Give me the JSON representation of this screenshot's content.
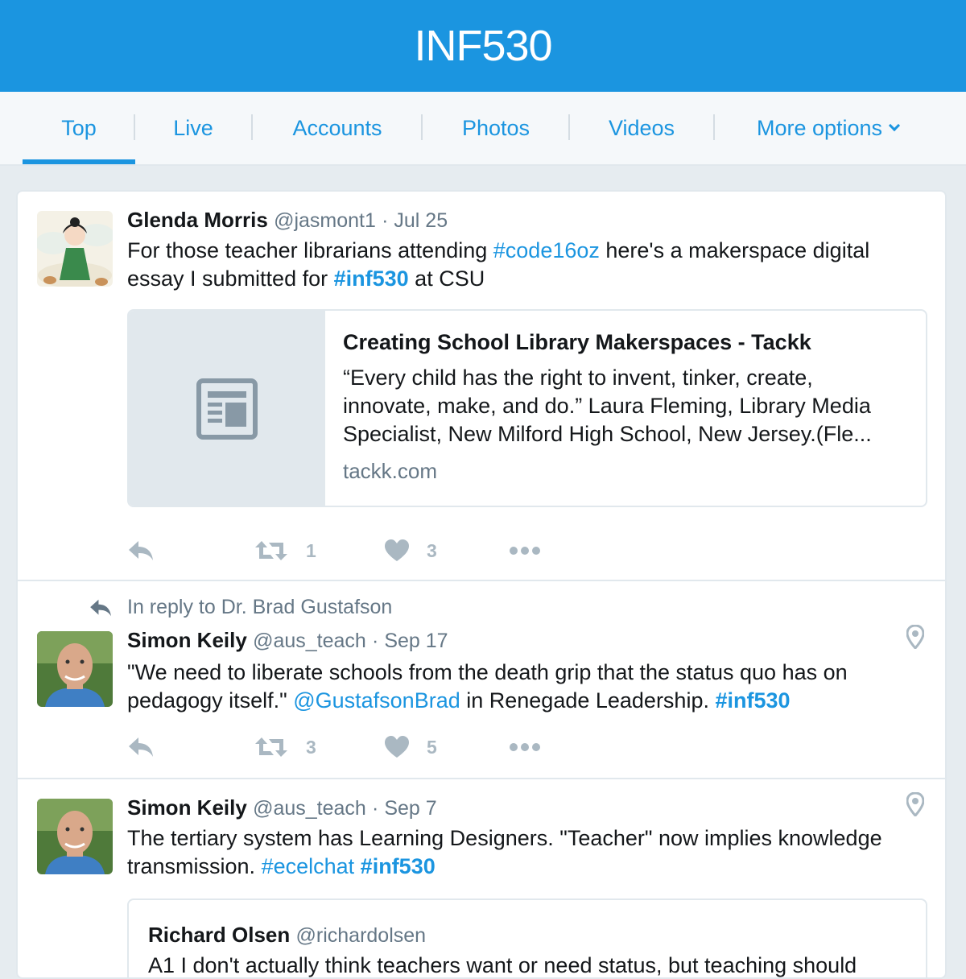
{
  "header": {
    "title": "INF530"
  },
  "tabs": [
    {
      "label": "Top",
      "active": true
    },
    {
      "label": "Live"
    },
    {
      "label": "Accounts"
    },
    {
      "label": "Photos"
    },
    {
      "label": "Videos"
    },
    {
      "label": "More options"
    }
  ],
  "tweets": [
    {
      "name": "Glenda Morris",
      "handle": "@jasmont1",
      "date": "· Jul 25",
      "text_parts": [
        "For those teacher librarians attending ",
        "#code16oz",
        " here's a makerspace digital essay I submitted for ",
        "#inf530",
        " at CSU"
      ],
      "card": {
        "title": "Creating School Library Makerspaces - Tackk",
        "description": "“Every child has the right to invent, tinker, create, innovate, make, and do.” Laura Fleming, Library Media Specialist, New Milford High School, New Jersey.(Fle...",
        "domain": "tackk.com"
      },
      "retweets": "1",
      "likes": "3"
    },
    {
      "reply_context": "In reply to Dr. Brad Gustafson",
      "name": "Simon Keily",
      "handle": "@aus_teach",
      "date": "· Sep 17",
      "text_parts": [
        "\"We need to liberate schools from the death grip that the status quo has on pedagogy itself.\" ",
        "@GustafsonBrad",
        " in Renegade Leadership. ",
        "#inf530"
      ],
      "retweets": "3",
      "likes": "5"
    },
    {
      "name": "Simon Keily",
      "handle": "@aus_teach",
      "date": "· Sep 7",
      "text_parts": [
        "The tertiary system has Learning Designers. \"Teacher\" now implies knowledge transmission. ",
        "#ecelchat",
        " ",
        "#inf530"
      ],
      "quote": {
        "name": "Richard Olsen",
        "handle": "@richardolsen",
        "text": "A1 I don't actually think teachers want or need status, but teaching should"
      }
    }
  ],
  "colors": {
    "brand": "#1b95e0",
    "muted": "#657786",
    "icon": "#aab8c2"
  }
}
